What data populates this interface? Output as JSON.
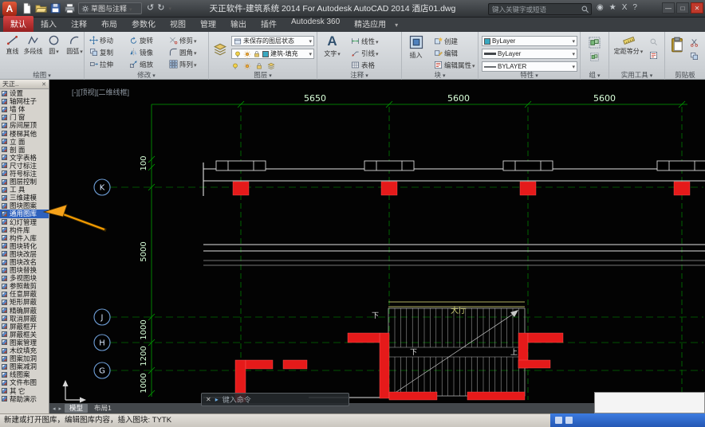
{
  "title_bar": {
    "app_logo": "A",
    "workspace": "草图与注释",
    "title": "天正软件-建筑系统 2014 For Autodesk AutoCAD 2014 酒店01.dwg",
    "search_placeholder": "键入关键字或短语"
  },
  "icons": {
    "caret": "▾",
    "close": "✕",
    "minimize": "—",
    "maximize": "□",
    "undo": "↺",
    "redo": "↻",
    "star": "★",
    "exchange": "X",
    "help": "?",
    "signin": "◉",
    "prompt": "▸",
    "nav_left": "◂",
    "nav_right": "▸",
    "text_tool": "A"
  },
  "ribbon": {
    "tabs": [
      {
        "label": "默认",
        "active": true
      },
      {
        "label": "插入"
      },
      {
        "label": "注释"
      },
      {
        "label": "布局"
      },
      {
        "label": "参数化"
      },
      {
        "label": "视图"
      },
      {
        "label": "管理"
      },
      {
        "label": "输出"
      },
      {
        "label": "插件"
      },
      {
        "label": "Autodesk 360"
      },
      {
        "label": "精选应用"
      }
    ],
    "draw": {
      "label": "绘图",
      "line": "直线",
      "polyline": "多段线",
      "circle": "圆",
      "arc": "圆弧"
    },
    "modify": {
      "label": "修改",
      "buttons": [
        "移动",
        "旋转",
        "修剪",
        "复制",
        "镜像",
        "圆角",
        "拉伸",
        "缩放",
        "阵列"
      ]
    },
    "layers": {
      "label": "图层",
      "state": "未保存的图层状态",
      "current": "建筑-填充"
    },
    "annotate": {
      "label": "注释",
      "text": "文字",
      "dim": "线性",
      "leader": "引线",
      "table": "表格"
    },
    "block": {
      "label": "块",
      "insert": "插入",
      "create": "创建",
      "edit": "编辑",
      "attrs": "编辑属性"
    },
    "properties": {
      "label": "特性",
      "color": "ByLayer",
      "lineweight": "ByLayer",
      "linetype": "BYLAYER"
    },
    "groups": {
      "label": "组"
    },
    "utilities": {
      "label": "实用工具",
      "measure": "定距等分"
    },
    "clipboard": {
      "label": "剪贴板"
    }
  },
  "sidebar": {
    "header": "天正..",
    "items": [
      {
        "label": "设置"
      },
      {
        "label": "轴网柱子"
      },
      {
        "label": "墙 体"
      },
      {
        "label": "门 窗"
      },
      {
        "label": "房间屋顶"
      },
      {
        "label": "楼梯其他"
      },
      {
        "label": "立 面"
      },
      {
        "label": "剖 面"
      },
      {
        "label": "文字表格"
      },
      {
        "label": "尺寸标注"
      },
      {
        "label": "符号标注"
      },
      {
        "label": "图层控制"
      },
      {
        "label": "工 具"
      },
      {
        "label": "三维建模"
      },
      {
        "label": "图块图案"
      },
      {
        "label": "通用图库",
        "selected": true
      },
      {
        "label": "幻灯管理"
      },
      {
        "label": "构件库"
      },
      {
        "label": "构件入库"
      },
      {
        "label": "图块转化"
      },
      {
        "label": "图块改层"
      },
      {
        "label": "图块改名"
      },
      {
        "label": "图块替换"
      },
      {
        "label": "多视图块"
      },
      {
        "label": "参照裁剪"
      },
      {
        "label": "任意屏蔽"
      },
      {
        "label": "矩形屏蔽"
      },
      {
        "label": "精确屏蔽"
      },
      {
        "label": "取消屏蔽"
      },
      {
        "label": "屏蔽框开"
      },
      {
        "label": "屏蔽框关"
      },
      {
        "label": "图案管理"
      },
      {
        "label": "木纹填充"
      },
      {
        "label": "图案加洞"
      },
      {
        "label": "图案减洞"
      },
      {
        "label": "线图案"
      },
      {
        "label": "文件布图"
      },
      {
        "label": "其 它"
      },
      {
        "label": "帮助演示"
      }
    ]
  },
  "canvas": {
    "viewport_label": "[-][顶视][二维线框]",
    "top_dims": [
      "5650",
      "5600",
      "5600"
    ],
    "left_dims": [
      "100",
      "5000",
      "1000",
      "1200",
      "1000"
    ],
    "axes": [
      "K",
      "J",
      "H",
      "G"
    ],
    "down_label": "下",
    "up_label": "上",
    "hall_label": "大厅"
  },
  "command_bar": {
    "prompt": "键入命令"
  },
  "bottom": {
    "tabs": [
      {
        "label": "模型",
        "active": true
      },
      {
        "label": "布局1"
      }
    ],
    "status": "新建或打开图库，编辑图库内容，插入图块: TYTK"
  }
}
